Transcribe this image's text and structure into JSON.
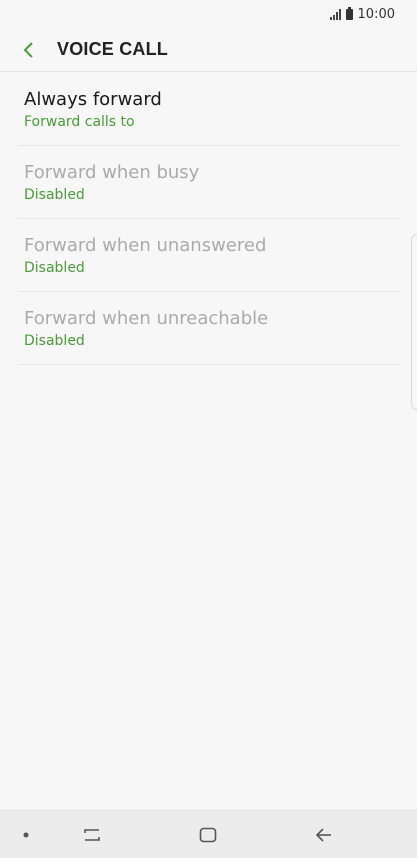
{
  "status_bar": {
    "time": "10:00",
    "signal_icon": "signal-icon",
    "battery_icon": "battery-icon"
  },
  "header": {
    "back_icon": "chevron-left-icon",
    "title": "VOICE CALL"
  },
  "items": [
    {
      "title": "Always forward",
      "subtitle": "Forward calls to",
      "enabled": true
    },
    {
      "title": "Forward when busy",
      "subtitle": "Disabled",
      "enabled": false
    },
    {
      "title": "Forward when unanswered",
      "subtitle": "Disabled",
      "enabled": false
    },
    {
      "title": "Forward when unreachable",
      "subtitle": "Disabled",
      "enabled": false
    }
  ],
  "nav_bar": {
    "icons": [
      "dot-icon",
      "recent-apps-icon",
      "home-icon",
      "back-arrow-icon"
    ]
  },
  "colors": {
    "accent": "#4b9c3a",
    "title_text": "#1a1a1a",
    "disabled_text": "#aaaaaa",
    "background": "#f7f7f7",
    "nav_background": "#ececec"
  }
}
